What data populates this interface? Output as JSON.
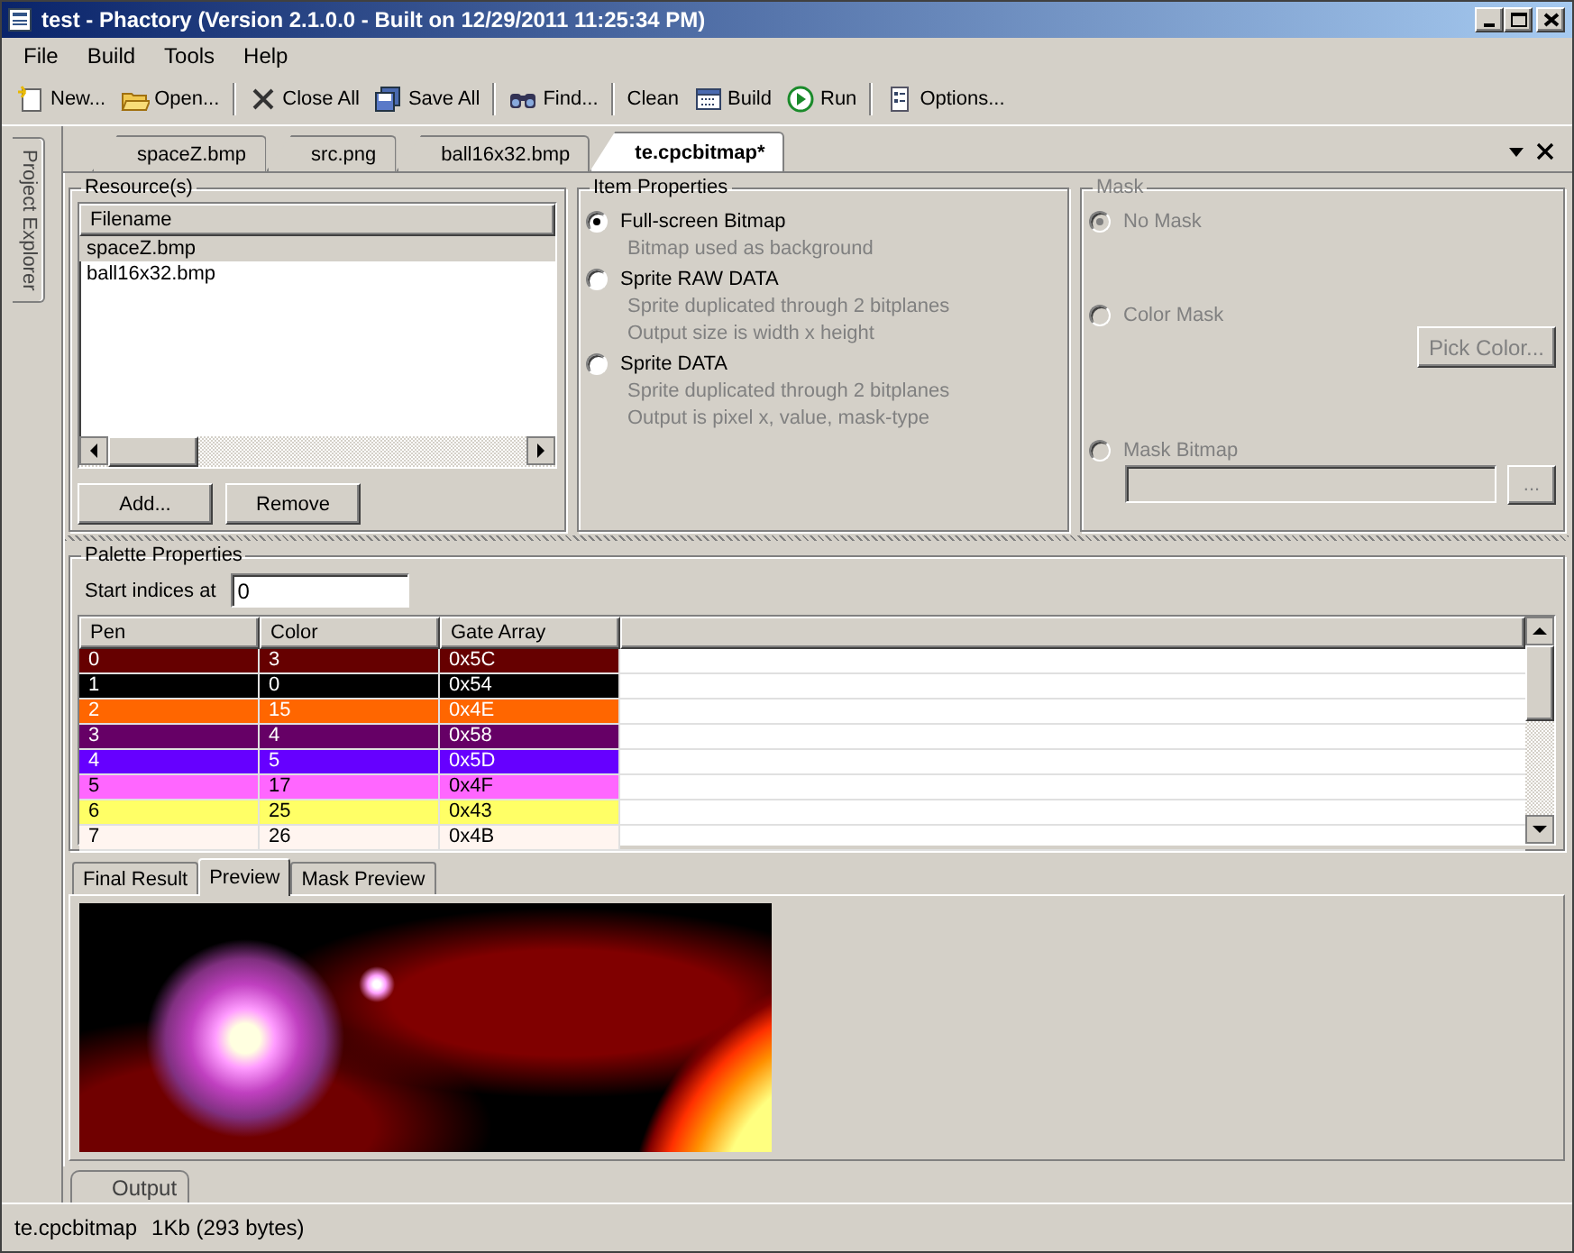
{
  "window": {
    "title": "test - Phactory (Version 2.1.0.0 - Built on 12/29/2011 11:25:34 PM)"
  },
  "menu": [
    "File",
    "Build",
    "Tools",
    "Help"
  ],
  "toolbar": [
    {
      "label": "New...",
      "kind": "new",
      "separator_after": false
    },
    {
      "label": "Open...",
      "kind": "open",
      "separator_after": true
    },
    {
      "label": "Close All",
      "kind": "close",
      "separator_after": false
    },
    {
      "label": "Save All",
      "kind": "save",
      "separator_after": true
    },
    {
      "label": "Find...",
      "kind": "find",
      "separator_after": true
    },
    {
      "label": "Clean",
      "kind": "text",
      "separator_after": false
    },
    {
      "label": "Build",
      "kind": "build",
      "separator_after": false
    },
    {
      "label": "Run",
      "kind": "run",
      "separator_after": true
    },
    {
      "label": "Options...",
      "kind": "options",
      "separator_after": false
    }
  ],
  "side_tab": "Project Explorer",
  "document_tabs": [
    {
      "label": "spaceZ.bmp",
      "selected": false
    },
    {
      "label": "src.png",
      "selected": false
    },
    {
      "label": "ball16x32.bmp",
      "selected": false
    },
    {
      "label": "te.cpcbitmap*",
      "selected": true
    }
  ],
  "resources": {
    "title": "Resource(s)",
    "column": "Filename",
    "files": [
      {
        "name": "spaceZ.bmp",
        "selected": true
      },
      {
        "name": "ball16x32.bmp",
        "selected": false
      }
    ],
    "buttons": [
      "Add...",
      "Remove"
    ]
  },
  "item_properties": {
    "title": "Item Properties",
    "options": [
      {
        "label": "Full-screen Bitmap",
        "selected": true,
        "notes": [
          "Bitmap used as background"
        ]
      },
      {
        "label": "Sprite RAW DATA",
        "selected": false,
        "notes": [
          "Sprite duplicated through 2 bitplanes",
          "Output size is width x height"
        ]
      },
      {
        "label": "Sprite DATA",
        "selected": false,
        "notes": [
          "Sprite duplicated through 2 bitplanes",
          "Output is pixel x, value, mask-type"
        ]
      }
    ]
  },
  "mask": {
    "title": "Mask",
    "disabled": true,
    "options": [
      {
        "label": "No Mask",
        "selected": true,
        "kind": "plain"
      },
      {
        "label": "Color Mask",
        "selected": false,
        "kind": "button",
        "button": "Pick Color..."
      },
      {
        "label": "Mask Bitmap",
        "selected": false,
        "kind": "file",
        "button": "..."
      }
    ]
  },
  "palette": {
    "title": "Palette Properties",
    "start_label": "Start indices at",
    "start_value": "0",
    "columns": [
      "Pen",
      "Color",
      "Gate Array"
    ],
    "rows": [
      {
        "pen": "0",
        "color_index": "3",
        "gate_array": "0x5C",
        "color": "#660000"
      },
      {
        "pen": "1",
        "color_index": "0",
        "gate_array": "0x54",
        "color": "#000000"
      },
      {
        "pen": "2",
        "color_index": "15",
        "gate_array": "0x4E",
        "color": "#ff6600"
      },
      {
        "pen": "3",
        "color_index": "4",
        "gate_array": "0x58",
        "color": "#660066"
      },
      {
        "pen": "4",
        "color_index": "5",
        "gate_array": "0x5D",
        "color": "#6600ff"
      },
      {
        "pen": "5",
        "color_index": "17",
        "gate_array": "0x4F",
        "color": "#ff66ff"
      },
      {
        "pen": "6",
        "color_index": "25",
        "gate_array": "0x43",
        "color": "#ffff66"
      },
      {
        "pen": "7",
        "color_index": "26",
        "gate_array": "0x4B",
        "color": "#fff5f0"
      }
    ]
  },
  "preview_tabs": [
    {
      "label": "Final Result",
      "selected": false
    },
    {
      "label": "Preview",
      "selected": true
    },
    {
      "label": "Mask Preview",
      "selected": false
    }
  ],
  "output_tab": "Output",
  "status_bar": [
    "te.cpcbitmap",
    "1Kb (293 bytes)"
  ]
}
